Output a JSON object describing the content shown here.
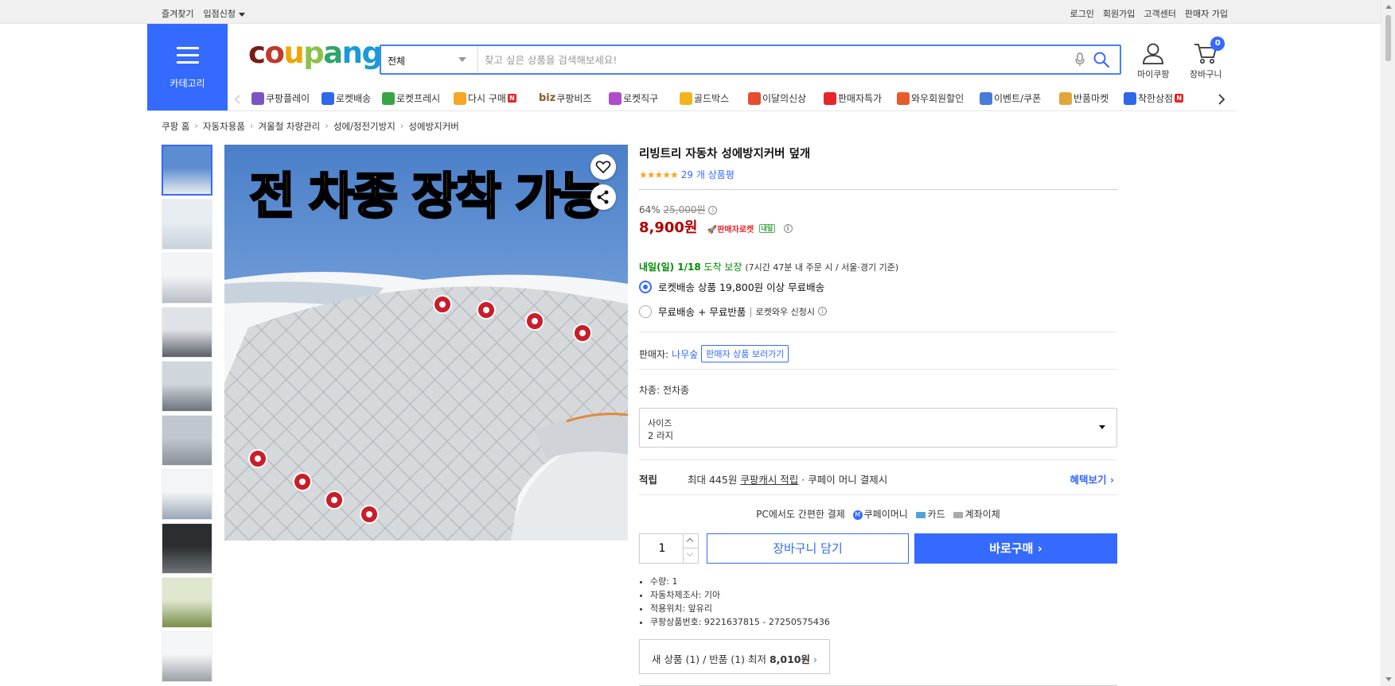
{
  "topbar": {
    "left": [
      "즐겨찾기",
      "입점신청"
    ],
    "right": [
      "로그인",
      "회원가입",
      "고객센터",
      "판매자 가입"
    ]
  },
  "category_label": "카테고리",
  "logo": {
    "letters": [
      "c",
      "o",
      "u",
      "p",
      "a",
      "n",
      "g"
    ],
    "colors": [
      "#7a1c14",
      "#c0392b",
      "#f0a500",
      "#8bc34a",
      "#2ea56a",
      "#1a9ad6",
      "#1a9ad6"
    ]
  },
  "search": {
    "scope": "전체",
    "placeholder": "찾고 싶은 상품을 검색해보세요!"
  },
  "header_icons": {
    "mycoupang": "마이쿠팡",
    "cart": "장바구니",
    "cart_count": "0"
  },
  "nav": [
    {
      "label": "쿠팡플레이",
      "icon": "coupang-play-icon",
      "color": "#7b55c6"
    },
    {
      "label": "로켓배송",
      "icon": "rocket-icon",
      "color": "#2f68e9"
    },
    {
      "label": "로켓프레시",
      "icon": "rocket-fresh-icon",
      "color": "#38a544"
    },
    {
      "label": "다시 구매",
      "icon": "basket-icon",
      "color": "#f5a623",
      "badge": "N"
    },
    {
      "label": "쿠팡비즈",
      "prefix": "biz",
      "icon": "biz-icon",
      "color": "#8b5a2b"
    },
    {
      "label": "로켓직구",
      "icon": "rocket-global-icon",
      "color": "#b04bcc"
    },
    {
      "label": "골드박스",
      "icon": "goldbox-icon",
      "color": "#f1b51c"
    },
    {
      "label": "이달의신상",
      "icon": "new-bag-icon",
      "color": "#e64d2f"
    },
    {
      "label": "판매자특가",
      "icon": "percent-icon",
      "color": "#e52528"
    },
    {
      "label": "와우회원할인",
      "icon": "wow-icon",
      "color": "#e85a2a"
    },
    {
      "label": "이벤트/쿠폰",
      "icon": "coupon-icon",
      "color": "#4a7ad9"
    },
    {
      "label": "반품마켓",
      "icon": "market-icon",
      "color": "#e2a73a"
    },
    {
      "label": "착한상점",
      "icon": "good-store-icon",
      "color": "#2f68e9",
      "badge": "N"
    }
  ],
  "breadcrumb": [
    "쿠팡 홈",
    "자동차용품",
    "겨울철 차량관리",
    "성에/정전기방지",
    "성에방지커버"
  ],
  "product": {
    "banner_text": "전 차종 장착 가능",
    "title": "리빙트리 자동차 성에방지커버 덮개",
    "stars": "★★★★★",
    "reviews": "29 개 상품평",
    "discount_rate": "64%",
    "original_price": "25,000원",
    "sale_price": "8,900원",
    "rocket_tag": "판매자로켓",
    "rocket_sub": "내일",
    "delivery_date": "내일(일) 1/18",
    "delivery_guarantee": "도착 보장",
    "delivery_note": "(7시간 47분 내 주문 시 / 서울·경기 기준)",
    "option1": "로켓배송 상품 19,800원 이상 무료배송",
    "option2_main": "무료배송 + 무료반품",
    "option2_note": "로켓와우 신청시",
    "seller_label": "판매자:",
    "seller_name": "나무숲",
    "seller_btn": "판매자 상품 보러가기",
    "car_type": "차종: 전차종",
    "size_label": "사이즈",
    "size_value": "2 라지",
    "points_head": "적립",
    "points_amount": "최대 445원",
    "points_link": "쿠팡캐시 적립",
    "points_tail": "· 쿠페이 머니 결제시",
    "points_more": "혜택보기 ›",
    "pay_title": "PC에서도 간편한 결제",
    "pay_methods": [
      "쿠페이머니",
      "카드",
      "계좌이체"
    ],
    "quantity": "1",
    "cart_btn": "장바구니 담기",
    "buy_btn": "바로구매 ›",
    "specs": [
      "수량: 1",
      "자동차제조사: 기아",
      "적용위치: 앞유리",
      "쿠팡상품번호: 9221637815 - 27250575436"
    ],
    "new_used_a": "새 상품 (1) / 반품 (1) 최저",
    "new_used_b": "8,010원",
    "new_used_c": "›"
  }
}
